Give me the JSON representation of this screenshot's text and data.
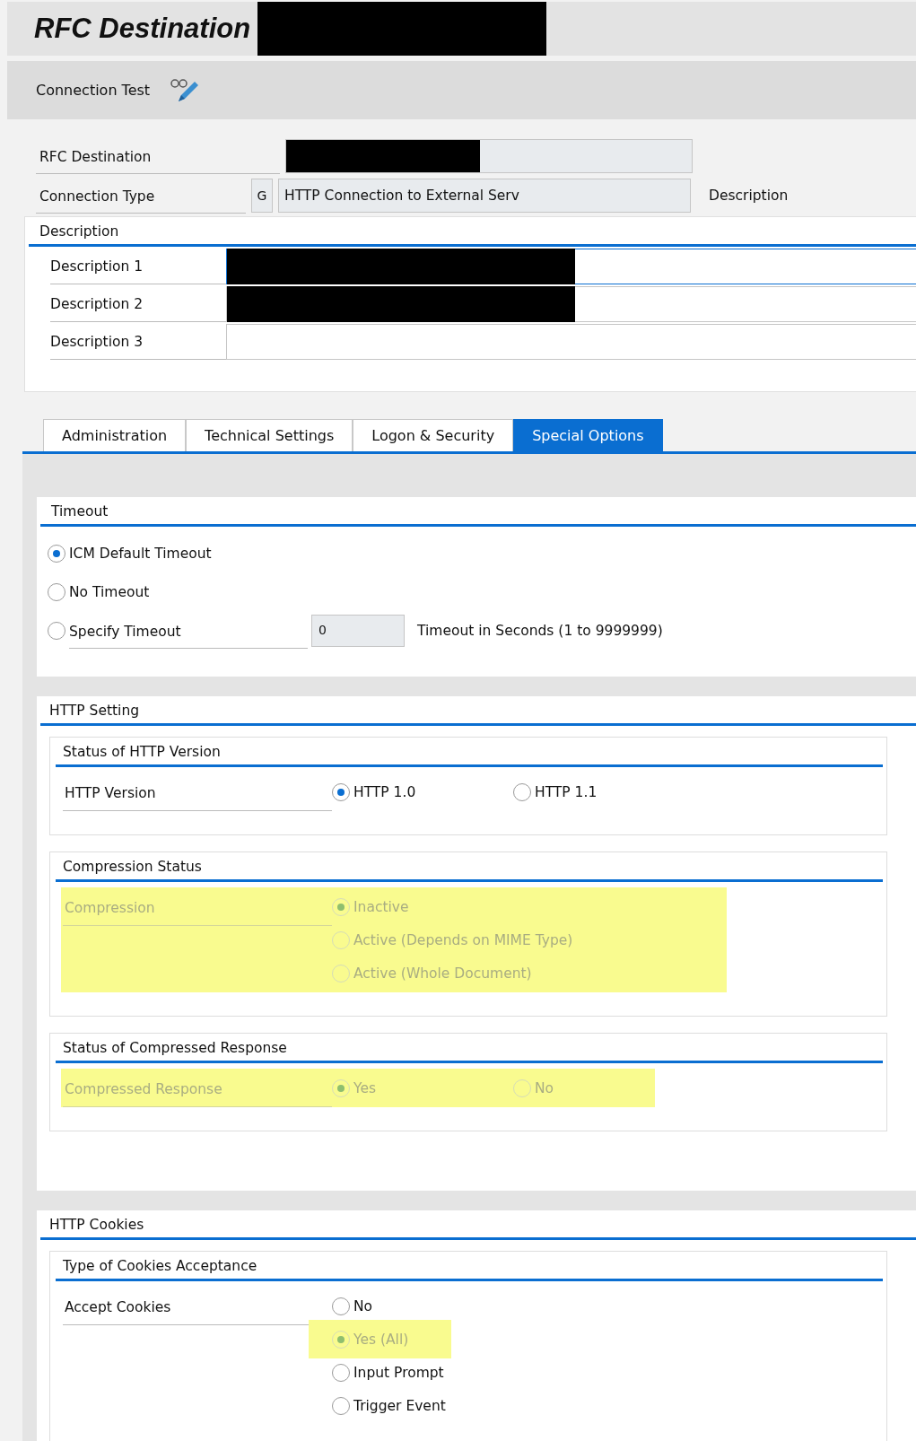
{
  "header": {
    "title": "RFC Destination",
    "redacted": true
  },
  "toolbar": {
    "buttons": [
      {
        "label": "Connection Test"
      }
    ]
  },
  "fields": [
    {
      "label": "RFC Destination",
      "redacted": true
    },
    {
      "label": "Connection Type",
      "code": "G",
      "value": "HTTP Connection to External Serv",
      "note": "Description"
    }
  ],
  "description": {
    "title": "Description",
    "fields": [
      {
        "label": "Description 1",
        "redacted": true
      },
      {
        "label": "Description 2",
        "redacted": true
      },
      {
        "label": "Description 3",
        "redacted": false
      }
    ]
  },
  "tabs": [
    {
      "label": "Administration",
      "selected": false
    },
    {
      "label": "Technical Settings",
      "selected": false
    },
    {
      "label": "Logon & Security",
      "selected": false
    },
    {
      "label": "Special Options",
      "selected": true
    }
  ],
  "timeout": {
    "title": "Timeout",
    "options": [
      {
        "label": "ICM Default Timeout",
        "selected": true
      },
      {
        "label": "No Timeout",
        "selected": false
      },
      {
        "label": "Specify Timeout",
        "selected": false,
        "value": "0",
        "hint": "Timeout in Seconds (1 to 9999999)"
      }
    ]
  },
  "sections": [
    {
      "title": "HTTP Setting",
      "groups": [
        {
          "title": "Status of HTTP Version",
          "label": "HTTP Version",
          "kind": "row",
          "highlighted": false,
          "disabled": false,
          "options": [
            {
              "label": "HTTP 1.0",
              "selected": true,
              "highlighted": false
            },
            {
              "label": "HTTP 1.1",
              "selected": false,
              "highlighted": false
            }
          ]
        },
        {
          "title": "Compression Status",
          "label": "Compression",
          "kind": "column",
          "highlighted": true,
          "disabled": true,
          "options": [
            {
              "label": "Inactive",
              "selected": true,
              "highlighted": false
            },
            {
              "label": "Active (Depends on MIME Type)",
              "selected": false,
              "highlighted": false
            },
            {
              "label": "Active (Whole Document)",
              "selected": false,
              "highlighted": false
            }
          ]
        },
        {
          "title": "Status of Compressed Response",
          "label": "Compressed Response",
          "kind": "row",
          "highlighted": true,
          "disabled": true,
          "options": [
            {
              "label": "Yes",
              "selected": true,
              "highlighted": false
            },
            {
              "label": "No",
              "selected": false,
              "highlighted": false
            }
          ]
        }
      ]
    },
    {
      "title": "HTTP Cookies",
      "groups": [
        {
          "title": "Type of Cookies Acceptance",
          "label": "Accept Cookies",
          "kind": "column",
          "highlighted": false,
          "disabled": false,
          "options": [
            {
              "label": "No",
              "selected": false,
              "highlighted": false
            },
            {
              "label": "Yes (All)",
              "selected": true,
              "highlighted": true
            },
            {
              "label": "Input Prompt",
              "selected": false,
              "highlighted": false
            },
            {
              "label": "Trigger Event",
              "selected": false,
              "highlighted": false
            }
          ]
        }
      ]
    }
  ]
}
